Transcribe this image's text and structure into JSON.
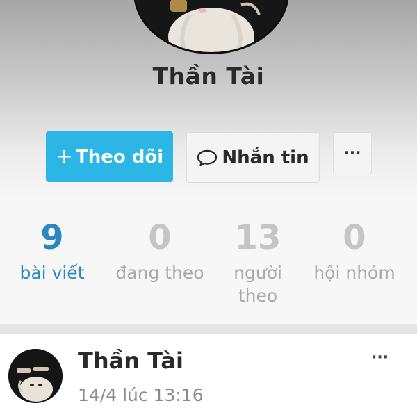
{
  "profile": {
    "name": "Thần Tài"
  },
  "actions": {
    "follow_plus": "+",
    "follow_label": "Theo dõi",
    "message_label": "Nhắn tin",
    "more_label": "···"
  },
  "stats": [
    {
      "value": "9",
      "label": "bài viết",
      "active": true
    },
    {
      "value": "0",
      "label": "đang theo",
      "active": false
    },
    {
      "value": "13",
      "label": "người theo",
      "active": false
    },
    {
      "value": "0",
      "label": "hội nhóm",
      "active": false
    }
  ],
  "post": {
    "author": "Thần Tài",
    "time": "14/4 lúc 13:16",
    "more_label": "···"
  },
  "colors": {
    "accent": "#2bb6e6",
    "active_stat": "#2a87bf"
  }
}
